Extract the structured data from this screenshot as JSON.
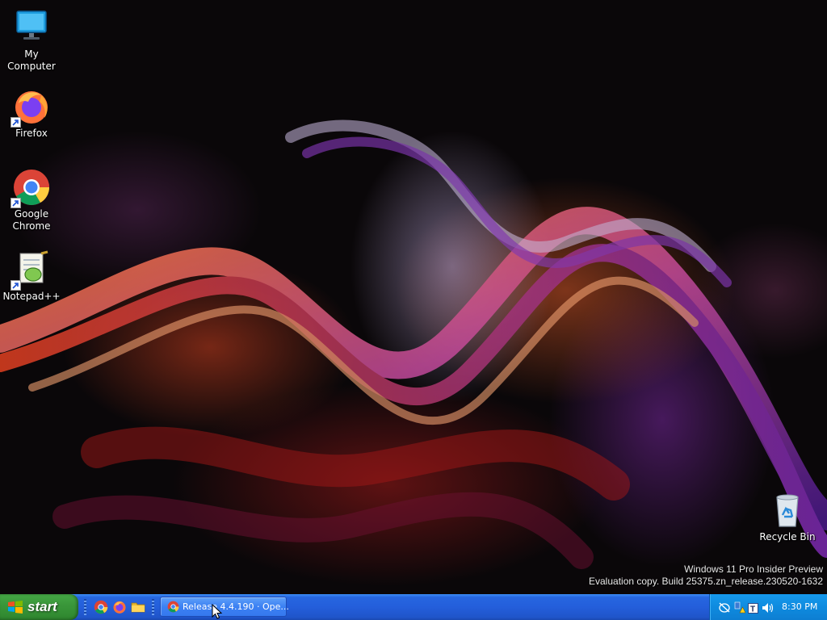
{
  "desktop": {
    "icons": [
      {
        "label": "My Computer",
        "icon": "my-computer-icon"
      },
      {
        "label": "Firefox",
        "icon": "firefox-icon",
        "shortcut": true
      },
      {
        "label": "Google Chrome",
        "icon": "chrome-icon",
        "shortcut": true
      },
      {
        "label": "Notepad++",
        "icon": "notepadpp-icon",
        "shortcut": true
      },
      {
        "label": "Recycle Bin",
        "icon": "recycle-bin-icon"
      }
    ],
    "watermark": {
      "line1": "Windows 11 Pro Insider Preview",
      "line2": "Evaluation copy. Build 25375.zn_release.230520-1632"
    }
  },
  "taskbar": {
    "start_label": "start",
    "quick_launch": [
      "chrome-icon",
      "firefox-icon",
      "file-explorer-icon"
    ],
    "tasks": [
      {
        "label": "Release 4.4.190 · Ope...",
        "icon": "chrome-icon",
        "active": false
      }
    ],
    "tray": {
      "icons": [
        "network-icon",
        "security-warning-icon",
        "t-app-icon",
        "volume-icon"
      ],
      "clock": "8:30 PM"
    }
  },
  "colors": {
    "taskbar_blue": "#245edb",
    "start_green": "#3a973a",
    "tray_blue": "#0f8bdf"
  }
}
